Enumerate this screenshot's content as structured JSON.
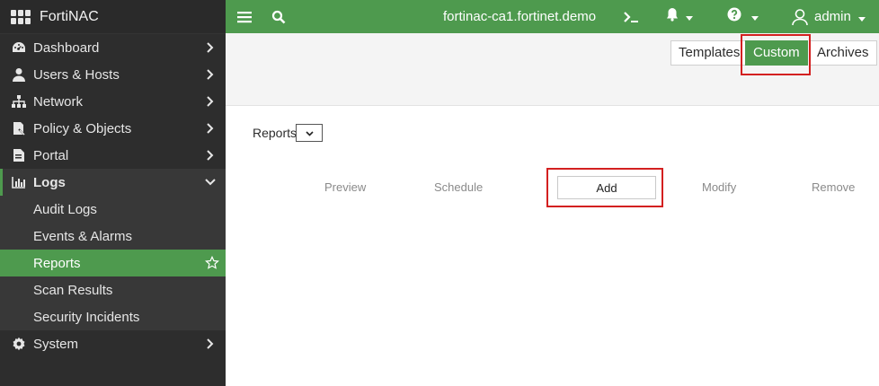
{
  "app": {
    "title": "FortiNAC"
  },
  "topbar": {
    "menu_icon": "hamburger-icon",
    "search_icon": "search-icon",
    "hostname": "fortinac-ca1.fortinet.demo",
    "terminal_icon": "terminal-icon",
    "bell_icon": "bell-icon",
    "help_icon": "help-icon",
    "user_icon": "user-icon",
    "user": "admin"
  },
  "sidebar": {
    "items": [
      {
        "label": "Dashboard",
        "icon": "dashboard-icon"
      },
      {
        "label": "Users & Hosts",
        "icon": "user-icon"
      },
      {
        "label": "Network",
        "icon": "network-icon"
      },
      {
        "label": "Policy & Objects",
        "icon": "policy-icon"
      },
      {
        "label": "Portal",
        "icon": "portal-icon"
      },
      {
        "label": "Logs",
        "icon": "logs-icon"
      },
      {
        "label": "System",
        "icon": "gear-icon"
      }
    ],
    "logs_sub": [
      {
        "label": "Audit Logs"
      },
      {
        "label": "Events & Alarms"
      },
      {
        "label": "Reports"
      },
      {
        "label": "Scan Results"
      },
      {
        "label": "Security Incidents"
      }
    ]
  },
  "header": {
    "tabs": [
      {
        "label": "Templates"
      },
      {
        "label": "Custom"
      },
      {
        "label": "Archives"
      }
    ],
    "selected_tab": "Custom"
  },
  "content": {
    "reports_label": "Reports",
    "actions": {
      "preview": "Preview",
      "schedule": "Schedule",
      "add": "Add",
      "modify": "Modify",
      "remove": "Remove"
    }
  },
  "colors": {
    "accent": "#4e9a4e",
    "sidebar_bg": "#2d2d2d",
    "highlight": "#d32020"
  }
}
